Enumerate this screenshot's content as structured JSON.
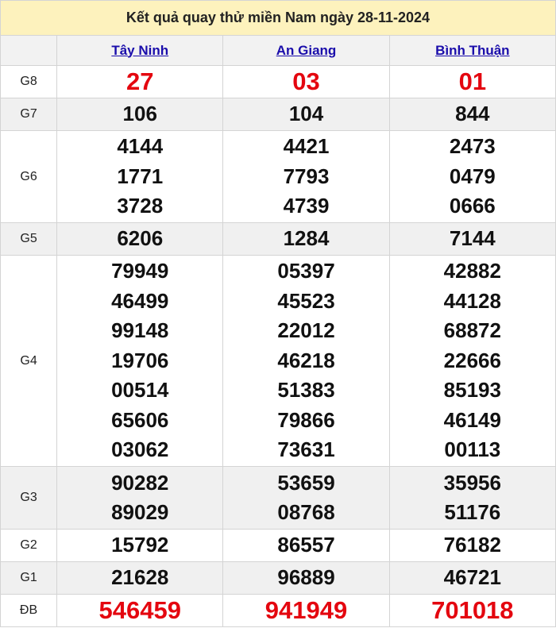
{
  "title": "Kết quả quay thử miền Nam ngày 28-11-2024",
  "provinces": [
    "Tây Ninh",
    "An Giang",
    "Bình Thuận"
  ],
  "rows": [
    {
      "label": "G8",
      "red": true,
      "values": [
        [
          "27"
        ],
        [
          "03"
        ],
        [
          "01"
        ]
      ]
    },
    {
      "label": "G7",
      "values": [
        [
          "106"
        ],
        [
          "104"
        ],
        [
          "844"
        ]
      ]
    },
    {
      "label": "G6",
      "values": [
        [
          "4144",
          "1771",
          "3728"
        ],
        [
          "4421",
          "7793",
          "4739"
        ],
        [
          "2473",
          "0479",
          "0666"
        ]
      ]
    },
    {
      "label": "G5",
      "values": [
        [
          "6206"
        ],
        [
          "1284"
        ],
        [
          "7144"
        ]
      ]
    },
    {
      "label": "G4",
      "values": [
        [
          "79949",
          "46499",
          "99148",
          "19706",
          "00514",
          "65606",
          "03062"
        ],
        [
          "05397",
          "45523",
          "22012",
          "46218",
          "51383",
          "79866",
          "73631"
        ],
        [
          "42882",
          "44128",
          "68872",
          "22666",
          "85193",
          "46149",
          "00113"
        ]
      ]
    },
    {
      "label": "G3",
      "values": [
        [
          "90282",
          "89029"
        ],
        [
          "53659",
          "08768"
        ],
        [
          "35956",
          "51176"
        ]
      ]
    },
    {
      "label": "G2",
      "values": [
        [
          "15792"
        ],
        [
          "86557"
        ],
        [
          "76182"
        ]
      ]
    },
    {
      "label": "G1",
      "values": [
        [
          "21628"
        ],
        [
          "96889"
        ],
        [
          "46721"
        ]
      ]
    },
    {
      "label": "ĐB",
      "red": true,
      "values": [
        [
          "546459"
        ],
        [
          "941949"
        ],
        [
          "701018"
        ]
      ]
    }
  ]
}
